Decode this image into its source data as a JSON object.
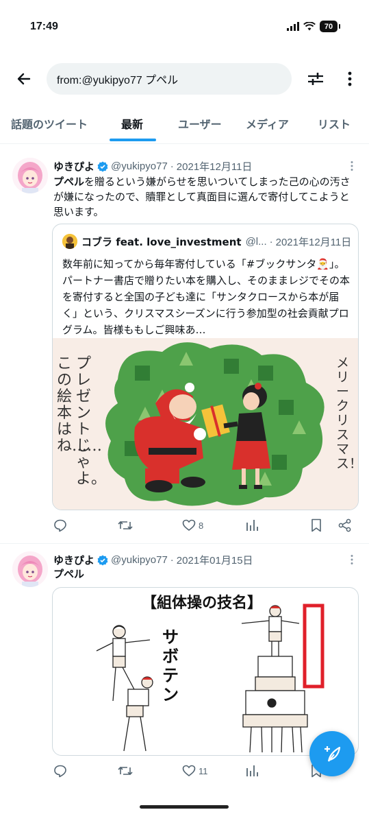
{
  "status_bar": {
    "time": "17:49",
    "battery": "70"
  },
  "search": {
    "query": "from:@yukipyo77 プペル"
  },
  "tabs": [
    {
      "label": "話題のツイート"
    },
    {
      "label": "最新"
    },
    {
      "label": "ユーザー"
    },
    {
      "label": "メディア"
    },
    {
      "label": "リスト"
    }
  ],
  "active_tab": "最新",
  "tweets": [
    {
      "name": "ゆきぴよ",
      "handle": "@yukipyo77",
      "dot": "·",
      "date": "2021年12月11日",
      "text_bold": "プペル",
      "text_rest": "を贈るという嫌がらせを思いついてしまった己の心の汚さが嫌になったので、贖罪として真面目に選んで寄付してこようと思います。",
      "quote": {
        "name": "コブラ feat. love_investment",
        "handle": "@l...",
        "dot": "·",
        "date": "2021年12月11日",
        "text": "数年前に知ってから毎年寄付している「#ブックサンタ🎅」。パートナー書店で贈りたい本を購入し、そのままレジでその本を寄付すると全国の子ども達に「サンタクロースから本が届く」という、クリスマスシーズンに行う参加型の社会貢献プログラム。皆様ももしご興味あ…",
        "image_text_left_1": "プレゼントじゃよ。",
        "image_text_left_2": "この絵本はね……",
        "image_text_right": "メリークリスマス！"
      },
      "actions": {
        "reply": "",
        "retweet": "",
        "like": "8",
        "views": "",
        "bookmark": "",
        "share": ""
      }
    },
    {
      "name": "ゆきぴよ",
      "handle": "@yukipyo77",
      "dot": "·",
      "date": "2021年01月15日",
      "text_bold": "プペル",
      "text_rest": "",
      "image": {
        "title": "【組体操の技名】",
        "label": "サボテン"
      },
      "actions": {
        "reply": "",
        "retweet": "",
        "like": "11",
        "views": "",
        "bookmark": ""
      }
    }
  ],
  "colors": {
    "accent": "#1d9bf0",
    "text": "#0f1419",
    "muted": "#536471",
    "border": "#cfd9de"
  },
  "icons": [
    "back-arrow-icon",
    "filter-icon",
    "more-vertical-icon",
    "verified-badge-icon",
    "reply-icon",
    "retweet-icon",
    "like-icon",
    "views-icon",
    "bookmark-icon",
    "share-icon",
    "compose-icon"
  ]
}
